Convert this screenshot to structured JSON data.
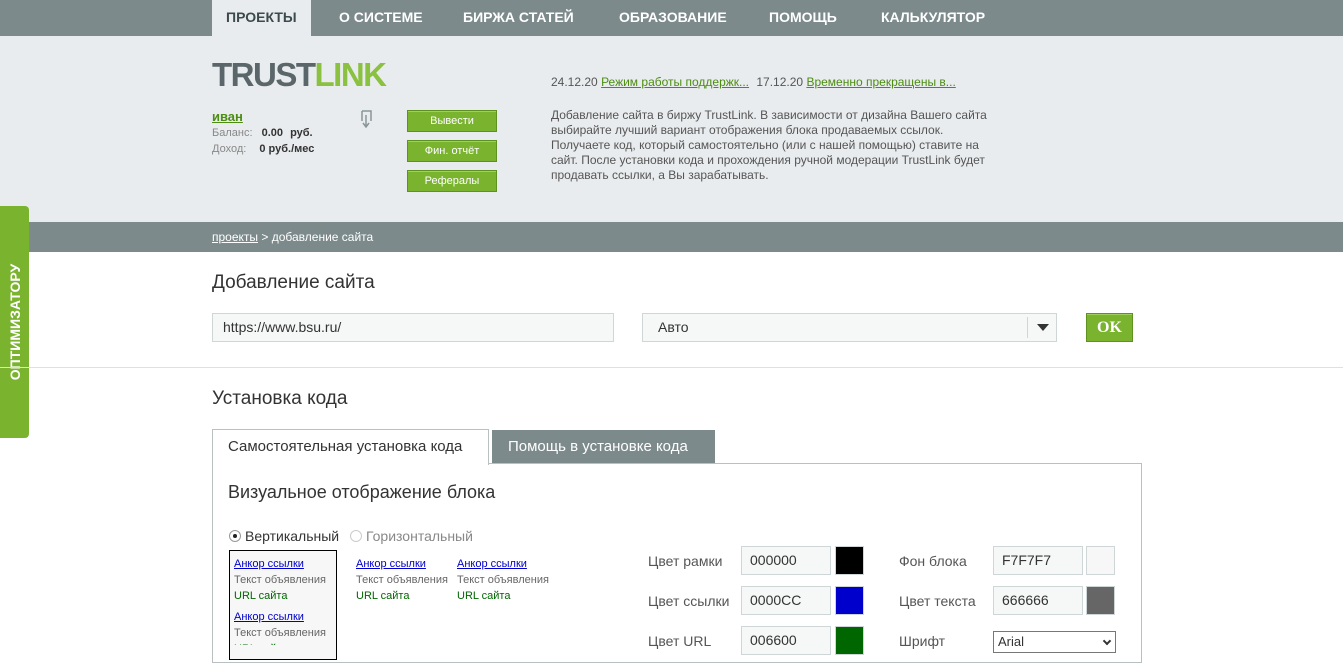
{
  "nav": {
    "tabs": [
      {
        "label": "ПРОЕКТЫ"
      },
      {
        "label": "О СИСТЕМЕ"
      },
      {
        "label": "БИРЖА СТАТЕЙ"
      },
      {
        "label": "ОБРАЗОВАНИЕ"
      },
      {
        "label": "ПОМОЩЬ"
      },
      {
        "label": "КАЛЬКУЛЯТОР"
      }
    ]
  },
  "header": {
    "logo_part1": "TRUST",
    "logo_part2": "LINK",
    "username": "иван",
    "balance_label": "Баланс:",
    "balance_value": "0.00",
    "balance_unit": "руб.",
    "income_label": "Доход:",
    "income_value": "0 руб./мес",
    "buttons": {
      "withdraw": "Вывести",
      "report": "Фин. отчёт",
      "referrals": "Рефералы"
    },
    "news": [
      {
        "date": "24.12.20",
        "title": "Режим работы поддержк..."
      },
      {
        "date": "17.12.20",
        "title": "Временно прекращены в..."
      }
    ],
    "intro_text": "Добавление сайта в биржу TrustLink. В зависимости от дизайна Вашего сайта выбирайте лучший вариант отображения блока продаваемых ссылок. Получаете код, который самостоятельно (или с нашей помощью) ставите на сайт. После установки кода и прохождения ручной модерации TrustLink будет продавать ссылки, а Вы зарабатывать."
  },
  "breadcrumb": {
    "link": "проекты",
    "separator": ">",
    "current": "добавление сайта"
  },
  "side_tab": "ОПТИМИЗАТОРУ",
  "add_site": {
    "title": "Добавление сайта",
    "url_value": "https://www.bsu.ru/",
    "select_value": "Авто",
    "ok_label": "OK"
  },
  "install": {
    "title": "Установка кода",
    "tab_self": "Самостоятельная установка кода",
    "tab_help": "Помощь в установке кода",
    "block_title": "Визуальное отображение блока",
    "layout_options": {
      "vertical": "Вертикальный",
      "horizontal": "Горизонтальный",
      "selected": "vertical"
    },
    "ad_sample": {
      "anchor": "Анкор ссылки",
      "text": "Текст объявления",
      "url": "URL сайта"
    },
    "fields": {
      "border_color": {
        "label": "Цвет рамки",
        "value": "000000",
        "color": "#000000"
      },
      "link_color": {
        "label": "Цвет ссылки",
        "value": "0000CC",
        "color": "#0000CC"
      },
      "url_color": {
        "label": "Цвет URL",
        "value": "006600",
        "color": "#006600"
      },
      "bg_color": {
        "label": "Фон блока",
        "value": "F7F7F7",
        "color": "#F7F7F7"
      },
      "text_color": {
        "label": "Цвет текста",
        "value": "666666",
        "color": "#666666"
      },
      "font": {
        "label": "Шрифт",
        "value": "Arial"
      }
    }
  },
  "colors": {
    "accent_green": "#7ab32e",
    "nav_gray": "#7c8a8c",
    "header_bg": "#e9ecee"
  }
}
